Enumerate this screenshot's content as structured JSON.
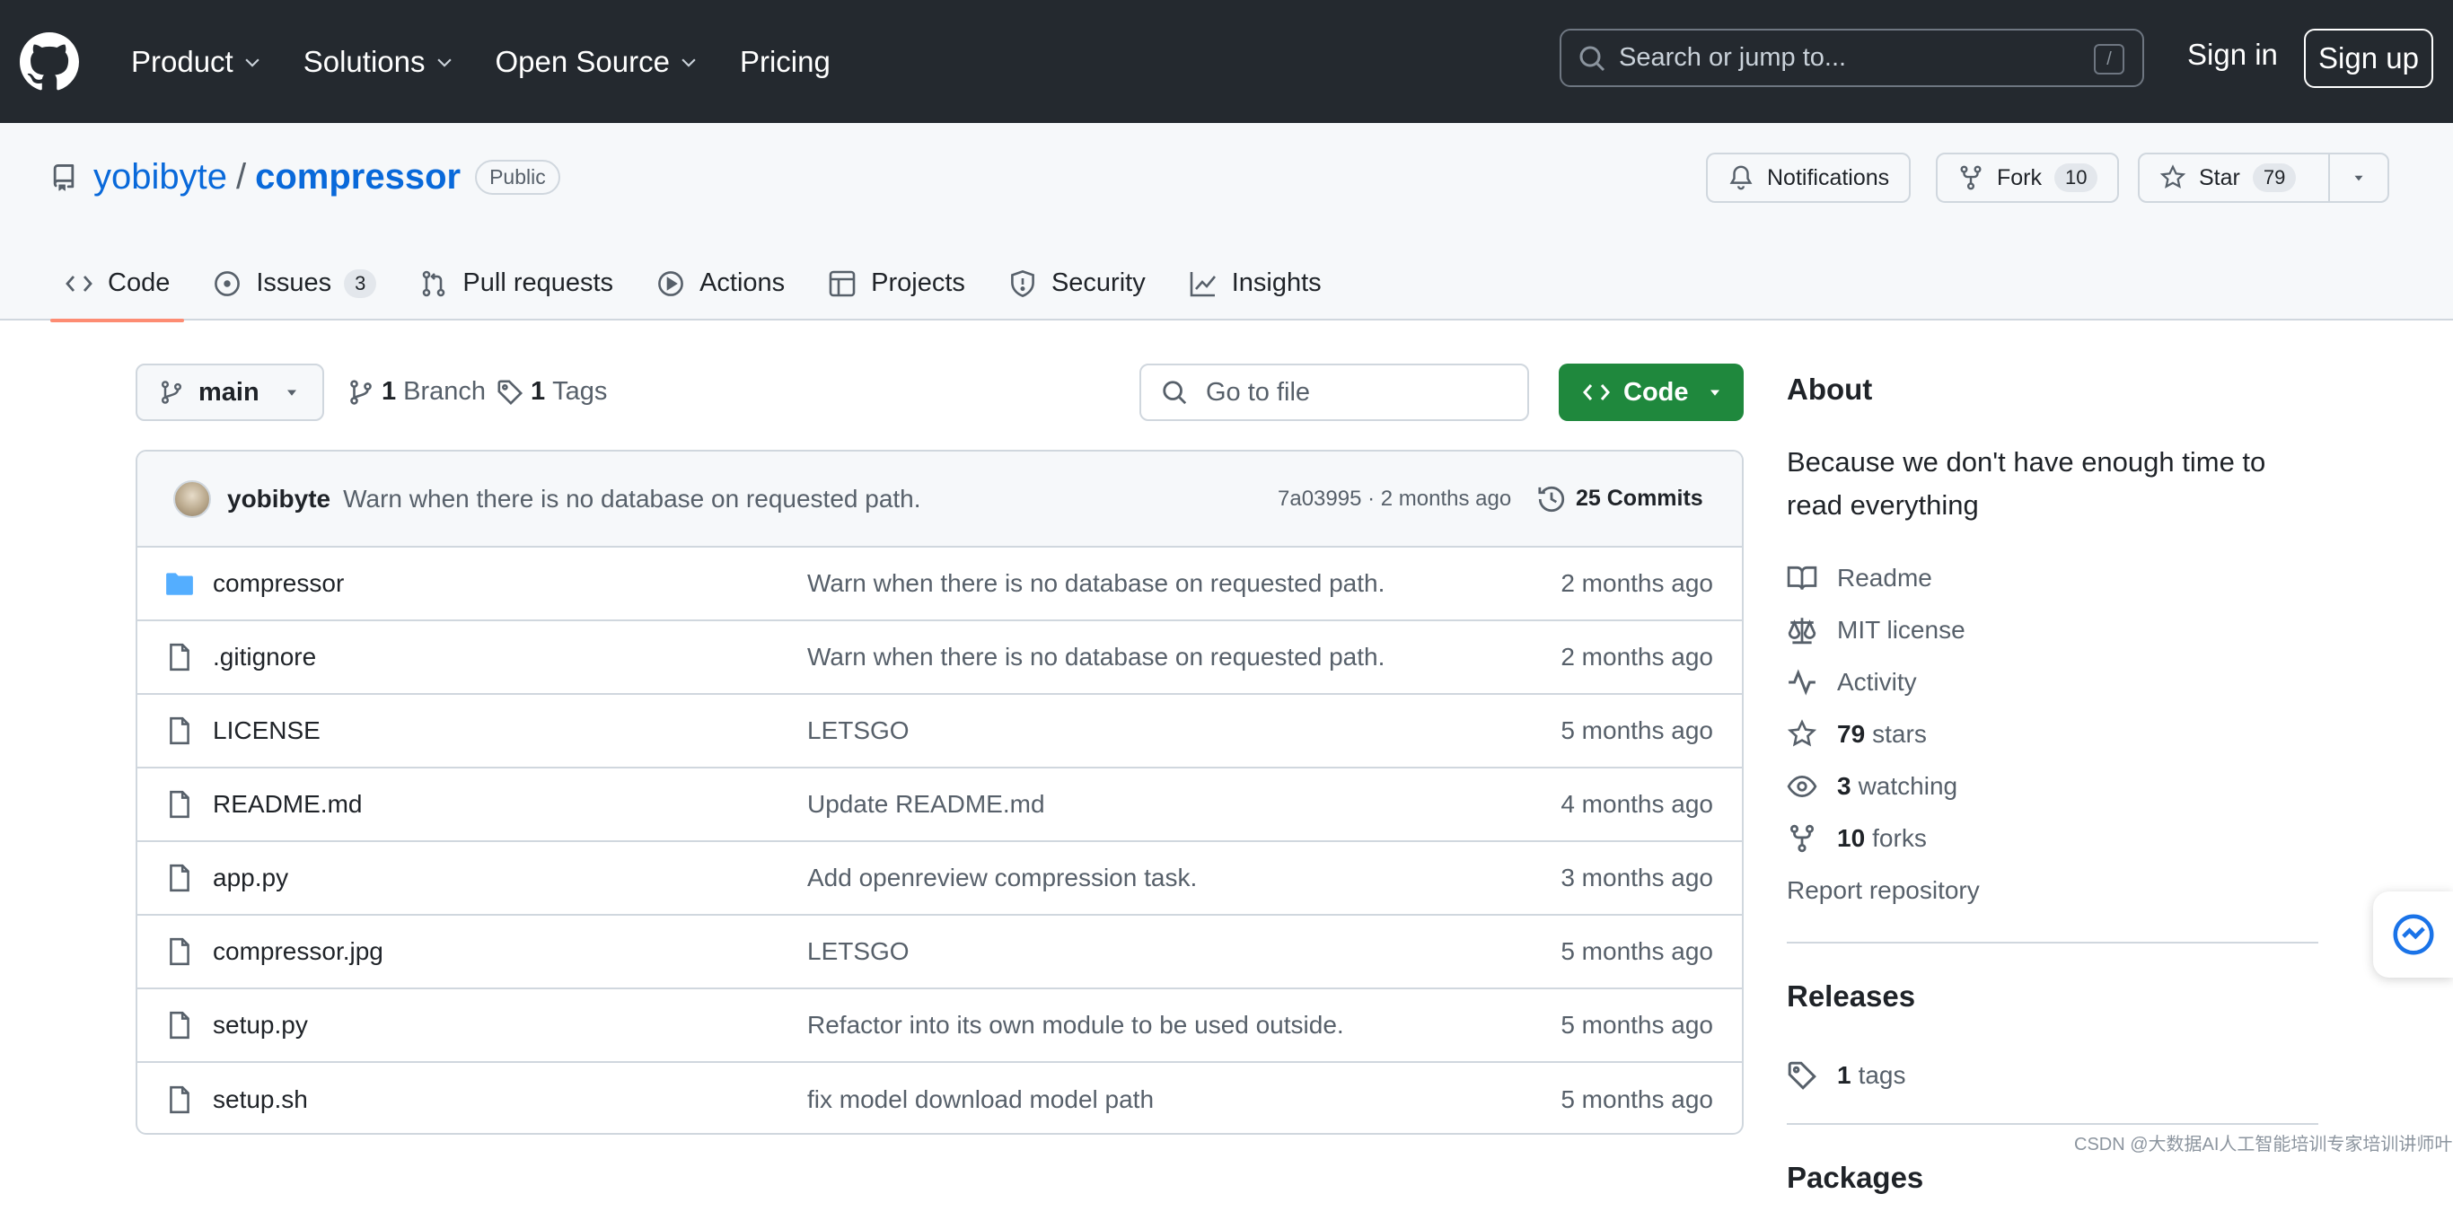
{
  "header": {
    "nav": [
      {
        "label": "Product",
        "dropdown": true
      },
      {
        "label": "Solutions",
        "dropdown": true
      },
      {
        "label": "Open Source",
        "dropdown": true
      },
      {
        "label": "Pricing",
        "dropdown": false
      }
    ],
    "search_placeholder": "Search or jump to...",
    "search_shortcut": "/",
    "sign_in": "Sign in",
    "sign_up": "Sign up",
    "bg_color": "#24292f"
  },
  "repo": {
    "owner": "yobibyte",
    "separator": "/",
    "name": "compressor",
    "visibility": "Public",
    "notifications_label": "Notifications",
    "fork_label": "Fork",
    "fork_count": "10",
    "star_label": "Star",
    "star_count": "79"
  },
  "tabs": [
    {
      "label": "Code",
      "icon": "code-icon",
      "active": true
    },
    {
      "label": "Issues",
      "icon": "issue-icon",
      "count": "3"
    },
    {
      "label": "Pull requests",
      "icon": "pull-request-icon"
    },
    {
      "label": "Actions",
      "icon": "play-icon"
    },
    {
      "label": "Projects",
      "icon": "table-icon"
    },
    {
      "label": "Security",
      "icon": "shield-icon"
    },
    {
      "label": "Insights",
      "icon": "graph-icon"
    }
  ],
  "toolbar": {
    "branch": "main",
    "branch_count": "1",
    "branch_label": "Branch",
    "tag_count": "1",
    "tag_label": "Tags",
    "go_to_file": "Go to file",
    "code_button": "Code",
    "code_button_color": "#1f883d"
  },
  "latest_commit": {
    "author": "yobibyte",
    "message": "Warn when there is no database on requested path.",
    "meta": "7a03995 · 2 months ago",
    "commits": "25 Commits"
  },
  "files": [
    {
      "name": "compressor",
      "type": "folder",
      "message": "Warn when there is no database on requested path.",
      "date": "2 months ago"
    },
    {
      "name": ".gitignore",
      "type": "file",
      "message": "Warn when there is no database on requested path.",
      "date": "2 months ago"
    },
    {
      "name": "LICENSE",
      "type": "file",
      "message": "LETSGO",
      "date": "5 months ago"
    },
    {
      "name": "README.md",
      "type": "file",
      "message": "Update README.md",
      "date": "4 months ago"
    },
    {
      "name": "app.py",
      "type": "file",
      "message": "Add openreview compression task.",
      "date": "3 months ago"
    },
    {
      "name": "compressor.jpg",
      "type": "file",
      "message": "LETSGO",
      "date": "5 months ago"
    },
    {
      "name": "setup.py",
      "type": "file",
      "message": "Refactor into its own module to be used outside.",
      "date": "5 months ago"
    },
    {
      "name": "setup.sh",
      "type": "file",
      "message": "fix model download model path",
      "date": "5 months ago"
    }
  ],
  "about": {
    "title": "About",
    "description": "Because we don't have enough time to read everything",
    "readme": "Readme",
    "license": "MIT license",
    "activity": "Activity",
    "stars_count": "79",
    "stars_label": "stars",
    "watching_count": "3",
    "watching_label": "watching",
    "forks_count": "10",
    "forks_label": "forks",
    "report": "Report repository"
  },
  "releases": {
    "title": "Releases",
    "tags_count": "1",
    "tags_label": "tags"
  },
  "packages": {
    "title": "Packages"
  },
  "watermark": "CSDN @大数据AI人工智能培训专家培训讲师叶"
}
